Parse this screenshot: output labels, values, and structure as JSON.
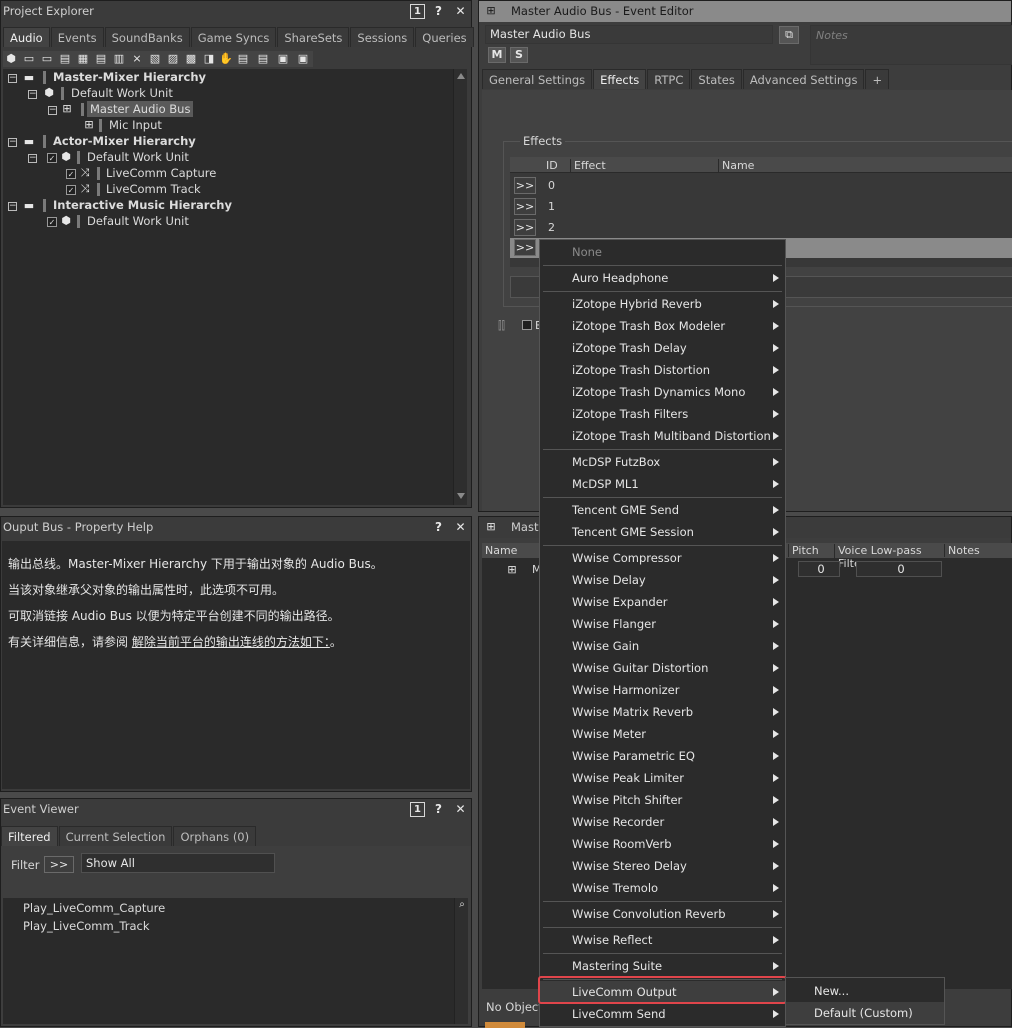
{
  "project_explorer": {
    "title": "Project Explorer",
    "tabs": [
      "Audio",
      "Events",
      "SoundBanks",
      "Game Syncs",
      "ShareSets",
      "Sessions",
      "Queries"
    ],
    "pin_label": "1",
    "help_label": "?",
    "close_label": "✕",
    "tree": {
      "master_mixer": "Master-Mixer Hierarchy",
      "default_work_unit_1": "Default Work Unit",
      "master_audio_bus": "Master Audio Bus",
      "mic_input": "Mic Input",
      "actor_mixer": "Actor-Mixer Hierarchy",
      "default_work_unit_2": "Default Work Unit",
      "livecomm_capture": "LiveComm Capture",
      "livecomm_track": "LiveComm Track",
      "interactive_music": "Interactive Music Hierarchy",
      "default_work_unit_3": "Default Work Unit"
    }
  },
  "property_help": {
    "title": "Ouput Bus - Property Help",
    "lines": [
      "输出总线。Master-Mixer Hierarchy 下用于输出对象的 Audio Bus。",
      "当该对象继承父对象的输出属性时，此选项不可用。",
      "可取消链接 Audio Bus 以便为特定平台创建不同的输出路径。"
    ],
    "line4_prefix": "有关详细信息，请参阅 ",
    "line4_link": "解除当前平台的输出连线的方法如下：",
    "line4_suffix": "。"
  },
  "event_viewer": {
    "title": "Event Viewer",
    "tabs": [
      "Filtered",
      "Current Selection",
      "Orphans (0)"
    ],
    "filter_label": "Filter",
    "filter_button": ">>",
    "filter_value": "Show All",
    "items": [
      "Play_LiveComm_Capture",
      "Play_LiveComm_Track"
    ]
  },
  "event_editor": {
    "title": "Master Audio Bus - Event Editor",
    "name_field": "Master Audio Bus",
    "notes_placeholder": "Notes",
    "m_button": "M",
    "s_button": "S",
    "tabs": [
      "General Settings",
      "Effects",
      "RTPC",
      "States",
      "Advanced Settings",
      "+"
    ],
    "effects_group": "Effects",
    "columns": [
      "ID",
      "Effect",
      "Name"
    ],
    "rows": [
      {
        "btn": ">>",
        "id": "0"
      },
      {
        "btn": ">>",
        "id": "1"
      },
      {
        "btn": ">>",
        "id": "2"
      },
      {
        "btn": ">>",
        "id": ""
      }
    ],
    "bypass_label": "B"
  },
  "lower_editor": {
    "title": "Master",
    "columns": [
      "Name",
      "Pitch",
      "Voice Low-pass Filter",
      "Notes"
    ],
    "row_name": "M",
    "pitch_value": "0",
    "lpf_value": "0",
    "status": "No Object"
  },
  "context_menu": {
    "items": [
      {
        "label": "None",
        "disabled": true,
        "sub": false
      },
      {
        "label": "Auro Headphone",
        "sub": true
      },
      {
        "label": "iZotope Hybrid Reverb",
        "sub": true
      },
      {
        "label": "iZotope Trash Box Modeler",
        "sub": true
      },
      {
        "label": "iZotope Trash Delay",
        "sub": true
      },
      {
        "label": "iZotope Trash Distortion",
        "sub": true
      },
      {
        "label": "iZotope Trash Dynamics Mono",
        "sub": true
      },
      {
        "label": "iZotope Trash Filters",
        "sub": true
      },
      {
        "label": "iZotope Trash Multiband Distortion",
        "sub": true
      },
      {
        "label": "McDSP FutzBox",
        "sub": true
      },
      {
        "label": "McDSP ML1",
        "sub": true
      },
      {
        "label": "Tencent GME Send",
        "sub": true
      },
      {
        "label": "Tencent GME Session",
        "sub": true
      },
      {
        "label": "Wwise Compressor",
        "sub": true
      },
      {
        "label": "Wwise Delay",
        "sub": true
      },
      {
        "label": "Wwise Expander",
        "sub": true
      },
      {
        "label": "Wwise Flanger",
        "sub": true
      },
      {
        "label": "Wwise Gain",
        "sub": true
      },
      {
        "label": "Wwise Guitar Distortion",
        "sub": true
      },
      {
        "label": "Wwise Harmonizer",
        "sub": true
      },
      {
        "label": "Wwise Matrix Reverb",
        "sub": true
      },
      {
        "label": "Wwise Meter",
        "sub": true
      },
      {
        "label": "Wwise Parametric EQ",
        "sub": true
      },
      {
        "label": "Wwise Peak Limiter",
        "sub": true
      },
      {
        "label": "Wwise Pitch Shifter",
        "sub": true
      },
      {
        "label": "Wwise Recorder",
        "sub": true
      },
      {
        "label": "Wwise RoomVerb",
        "sub": true
      },
      {
        "label": "Wwise Stereo Delay",
        "sub": true
      },
      {
        "label": "Wwise Tremolo",
        "sub": true
      },
      {
        "label": "Wwise Convolution Reverb",
        "sub": true
      },
      {
        "label": "Wwise Reflect",
        "sub": true
      },
      {
        "label": "Mastering Suite",
        "sub": true
      },
      {
        "label": "LiveComm Output",
        "sub": true,
        "highlighted": true
      },
      {
        "label": "LiveComm Send",
        "sub": true
      }
    ],
    "submenu": [
      "New...",
      "Default (Custom)"
    ]
  },
  "colors": {
    "highlight": "#e0454b",
    "selection": "#5a5a5a"
  }
}
